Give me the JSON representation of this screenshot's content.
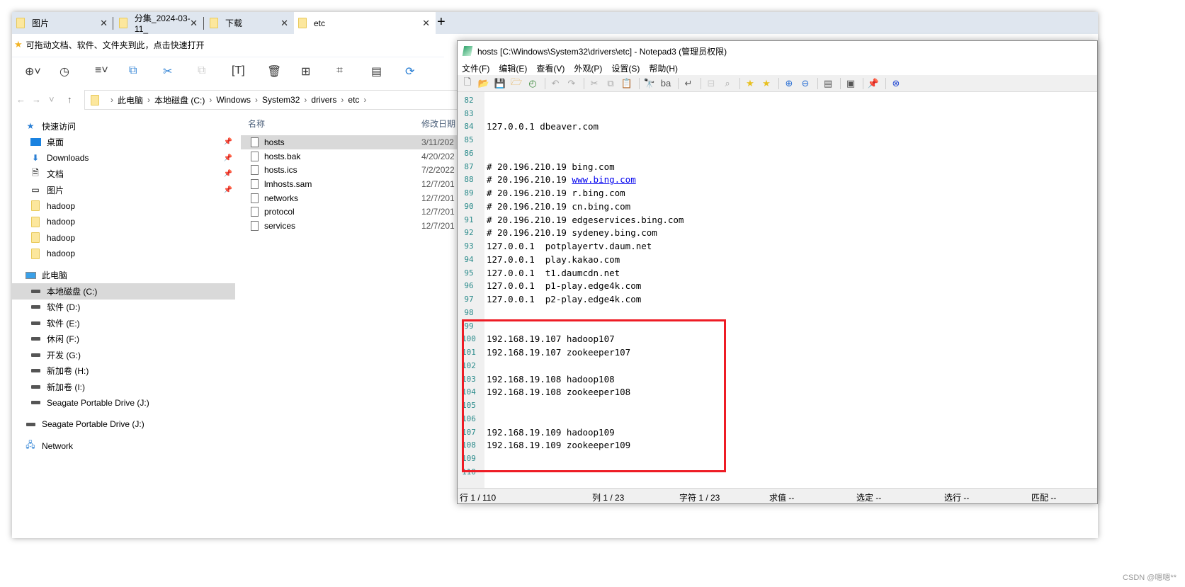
{
  "explorer": {
    "tabs": [
      {
        "label": "图片"
      },
      {
        "label": "分集_2024-03-11_"
      },
      {
        "label": "下载"
      },
      {
        "label": "etc"
      }
    ],
    "quick_hint": "可拖动文档、软件、文件夹到此，点击快速打开",
    "breadcrumb": [
      "此电脑",
      "本地磁盘 (C:)",
      "Windows",
      "System32",
      "drivers",
      "etc"
    ],
    "nav": {
      "quick_access": "快速访问",
      "pinned": [
        {
          "label": "桌面"
        },
        {
          "label": "Downloads"
        },
        {
          "label": "文档"
        },
        {
          "label": "图片"
        }
      ],
      "folders": [
        {
          "label": "hadoop"
        },
        {
          "label": "hadoop"
        },
        {
          "label": "hadoop"
        },
        {
          "label": "hadoop"
        }
      ],
      "this_pc": "此电脑",
      "drives": [
        {
          "label": "本地磁盘 (C:)"
        },
        {
          "label": "软件 (D:)"
        },
        {
          "label": "软件 (E:)"
        },
        {
          "label": "休闲 (F:)"
        },
        {
          "label": "开发 (G:)"
        },
        {
          "label": "新加卷 (H:)"
        },
        {
          "label": "新加卷 (I:)"
        },
        {
          "label": "Seagate Portable Drive (J:)"
        }
      ],
      "external": "Seagate Portable Drive (J:)",
      "network": "Network"
    },
    "files": {
      "col_name": "名称",
      "col_date": "修改日期",
      "rows": [
        {
          "name": "hosts",
          "date": "3/11/202"
        },
        {
          "name": "hosts.bak",
          "date": "4/20/202"
        },
        {
          "name": "hosts.ics",
          "date": "7/2/2022"
        },
        {
          "name": "lmhosts.sam",
          "date": "12/7/201"
        },
        {
          "name": "networks",
          "date": "12/7/201"
        },
        {
          "name": "protocol",
          "date": "12/7/201"
        },
        {
          "name": "services",
          "date": "12/7/201"
        }
      ]
    }
  },
  "notepad": {
    "title": "hosts [C:\\Windows\\System32\\drivers\\etc] - Notepad3  (管理员权限)",
    "menu": [
      "文件(F)",
      "编辑(E)",
      "查看(V)",
      "外观(P)",
      "设置(S)",
      "帮助(H)"
    ],
    "lines": [
      {
        "n": "82",
        "t": ""
      },
      {
        "n": "83",
        "t": ""
      },
      {
        "n": "84",
        "t": "127.0.0.1 dbeaver.com"
      },
      {
        "n": "85",
        "t": ""
      },
      {
        "n": "86",
        "t": ""
      },
      {
        "n": "87",
        "t": "# 20.196.210.19 bing.com"
      },
      {
        "n": "88",
        "t": "# 20.196.210.19 ",
        "link": "www.bing.com"
      },
      {
        "n": "89",
        "t": "# 20.196.210.19 r.bing.com"
      },
      {
        "n": "90",
        "t": "# 20.196.210.19 cn.bing.com"
      },
      {
        "n": "91",
        "t": "# 20.196.210.19 edgeservices.bing.com"
      },
      {
        "n": "92",
        "t": "# 20.196.210.19 sydeney.bing.com"
      },
      {
        "n": "93",
        "t": "127.0.0.1  potplayertv.daum.net"
      },
      {
        "n": "94",
        "t": "127.0.0.1  play.kakao.com"
      },
      {
        "n": "95",
        "t": "127.0.0.1  t1.daumcdn.net"
      },
      {
        "n": "96",
        "t": "127.0.0.1  p1-play.edge4k.com"
      },
      {
        "n": "97",
        "t": "127.0.0.1  p2-play.edge4k.com"
      },
      {
        "n": "98",
        "t": ""
      },
      {
        "n": "99",
        "t": ""
      },
      {
        "n": "100",
        "t": "192.168.19.107 hadoop107"
      },
      {
        "n": "101",
        "t": "192.168.19.107 zookeeper107"
      },
      {
        "n": "102",
        "t": ""
      },
      {
        "n": "103",
        "t": "192.168.19.108 hadoop108"
      },
      {
        "n": "104",
        "t": "192.168.19.108 zookeeper108"
      },
      {
        "n": "105",
        "t": ""
      },
      {
        "n": "106",
        "t": ""
      },
      {
        "n": "107",
        "t": "192.168.19.109 hadoop109"
      },
      {
        "n": "108",
        "t": "192.168.19.109 zookeeper109"
      },
      {
        "n": "109",
        "t": ""
      },
      {
        "n": "110",
        "t": ""
      }
    ],
    "status": {
      "line": "行 1 / 110",
      "col": "列  1 / 23",
      "char": "字符  1 / 23",
      "eval": "求值  --",
      "sel": "选定  --",
      "selline": "选行  --",
      "match": "匹配  --"
    },
    "highlight_color": "#ee1c25"
  },
  "watermark": "CSDN @嗯嗯**"
}
